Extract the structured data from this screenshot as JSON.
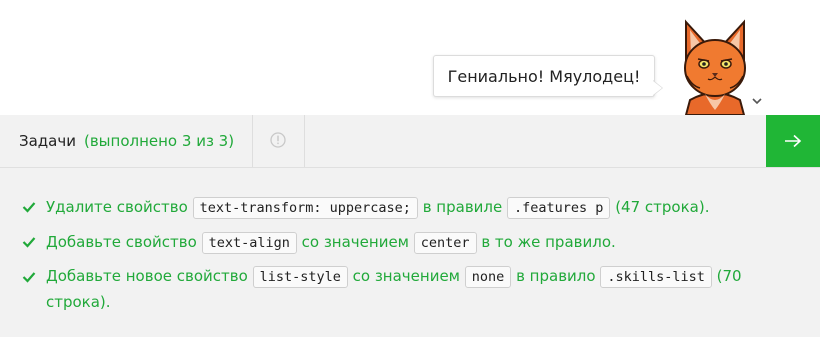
{
  "mascot": {
    "speech": "Гениально! Мяулодец!"
  },
  "tasks": {
    "title": "Задачи",
    "status": "(выполнено 3 из 3)"
  },
  "icons": {
    "info": "info-icon",
    "next": "arrow-right-icon",
    "check": "check-icon",
    "chevron": "chevron-down-icon"
  },
  "colors": {
    "accent": "#21a93a",
    "next_button": "#20b636",
    "cat": "#f07a30"
  },
  "items": [
    {
      "t1": "Удалите свойство",
      "c1": "text-transform: uppercase;",
      "t2": "в правиле",
      "c2": ".features p",
      "t3": "(47 строка)."
    },
    {
      "t1": "Добавьте свойство",
      "c1": "text-align",
      "t2": "со значением",
      "c2": "center",
      "t3": "в то же правило."
    },
    {
      "t1": "Добавьте новое свойство",
      "c1": "list-style",
      "t2": "со значением",
      "c2": "none",
      "t3": "в правило",
      "c3": ".skills-list",
      "t4": "(70 строка)."
    }
  ]
}
